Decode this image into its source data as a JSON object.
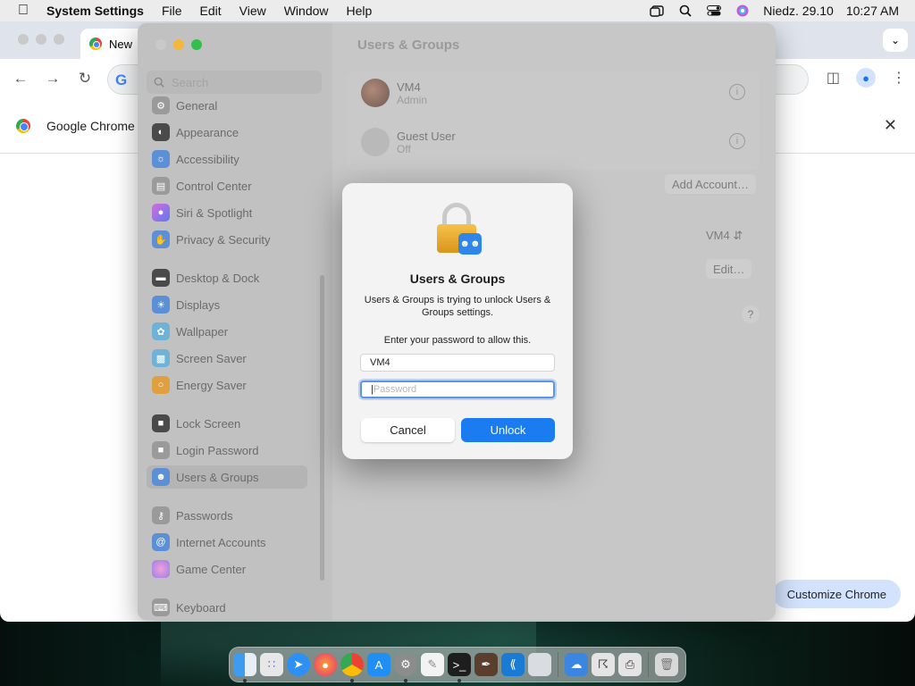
{
  "menubar": {
    "app_name": "System Settings",
    "menus": [
      "File",
      "Edit",
      "View",
      "Window",
      "Help"
    ],
    "date": "Niedz. 29.10",
    "time": "10:27 AM"
  },
  "chrome": {
    "tab_title": "New",
    "infobar_text": "Google Chrome i",
    "omnibox_logo": "G",
    "customize_label": "Customize Chrome"
  },
  "settings": {
    "title": "Users & Groups",
    "search_placeholder": "Search",
    "sidebar": [
      {
        "label": "General",
        "icon": "gear-icon",
        "color": "#9a9a9a"
      },
      {
        "label": "Appearance",
        "icon": "appearance-icon",
        "color": "#4a4a4a"
      },
      {
        "label": "Accessibility",
        "icon": "accessibility-icon",
        "color": "#5b8fd6"
      },
      {
        "label": "Control Center",
        "icon": "control-center-icon",
        "color": "#9a9a9a"
      },
      {
        "label": "Siri & Spotlight",
        "icon": "siri-icon",
        "color": "#b05fc9"
      },
      {
        "label": "Privacy & Security",
        "icon": "hand-icon",
        "color": "#5b8fd6"
      },
      {
        "label": "Desktop & Dock",
        "icon": "dock-icon",
        "color": "#4a4a4a"
      },
      {
        "label": "Displays",
        "icon": "sun-icon",
        "color": "#5b8fd6"
      },
      {
        "label": "Wallpaper",
        "icon": "wallpaper-icon",
        "color": "#6fb2d8"
      },
      {
        "label": "Screen Saver",
        "icon": "screen-saver-icon",
        "color": "#6fb2d8"
      },
      {
        "label": "Energy Saver",
        "icon": "bulb-icon",
        "color": "#e0a040"
      },
      {
        "label": "Lock Screen",
        "icon": "lock-icon",
        "color": "#4a4a4a"
      },
      {
        "label": "Login Password",
        "icon": "lock-icon",
        "color": "#9a9a9a"
      },
      {
        "label": "Users & Groups",
        "icon": "users-icon",
        "color": "#5b8fd6"
      },
      {
        "label": "Passwords",
        "icon": "key-icon",
        "color": "#9a9a9a"
      },
      {
        "label": "Internet Accounts",
        "icon": "at-icon",
        "color": "#5b8fd6"
      },
      {
        "label": "Game Center",
        "icon": "game-center-icon",
        "color": "#c77bd4"
      },
      {
        "label": "Keyboard",
        "icon": "keyboard-icon",
        "color": "#9a9a9a"
      }
    ],
    "users": [
      {
        "name": "VM4",
        "role": "Admin"
      },
      {
        "name": "Guest User",
        "role": "Off"
      }
    ],
    "add_account": "Add Account…",
    "autologin_value": "VM4",
    "edit_label": "Edit…",
    "help_label": "?"
  },
  "dialog": {
    "title": "Users & Groups",
    "message": "Users & Groups is trying to unlock Users & Groups settings.",
    "prompt": "Enter your password to allow this.",
    "username": "VM4",
    "password_placeholder": "Password",
    "cancel": "Cancel",
    "unlock": "Unlock"
  },
  "dock": [
    "Finder",
    "Launchpad",
    "Safari",
    "Firefox",
    "Chrome",
    "App Store",
    "System Settings",
    "TextEdit",
    "Terminal",
    "Brush",
    "VS Code",
    "Preview",
    "Weather",
    "Network",
    "Printer",
    "Trash"
  ],
  "colors": {
    "accent": "#1b7cf2",
    "unlock_button": "#1b7cf2",
    "lock": "#f6c24a"
  }
}
